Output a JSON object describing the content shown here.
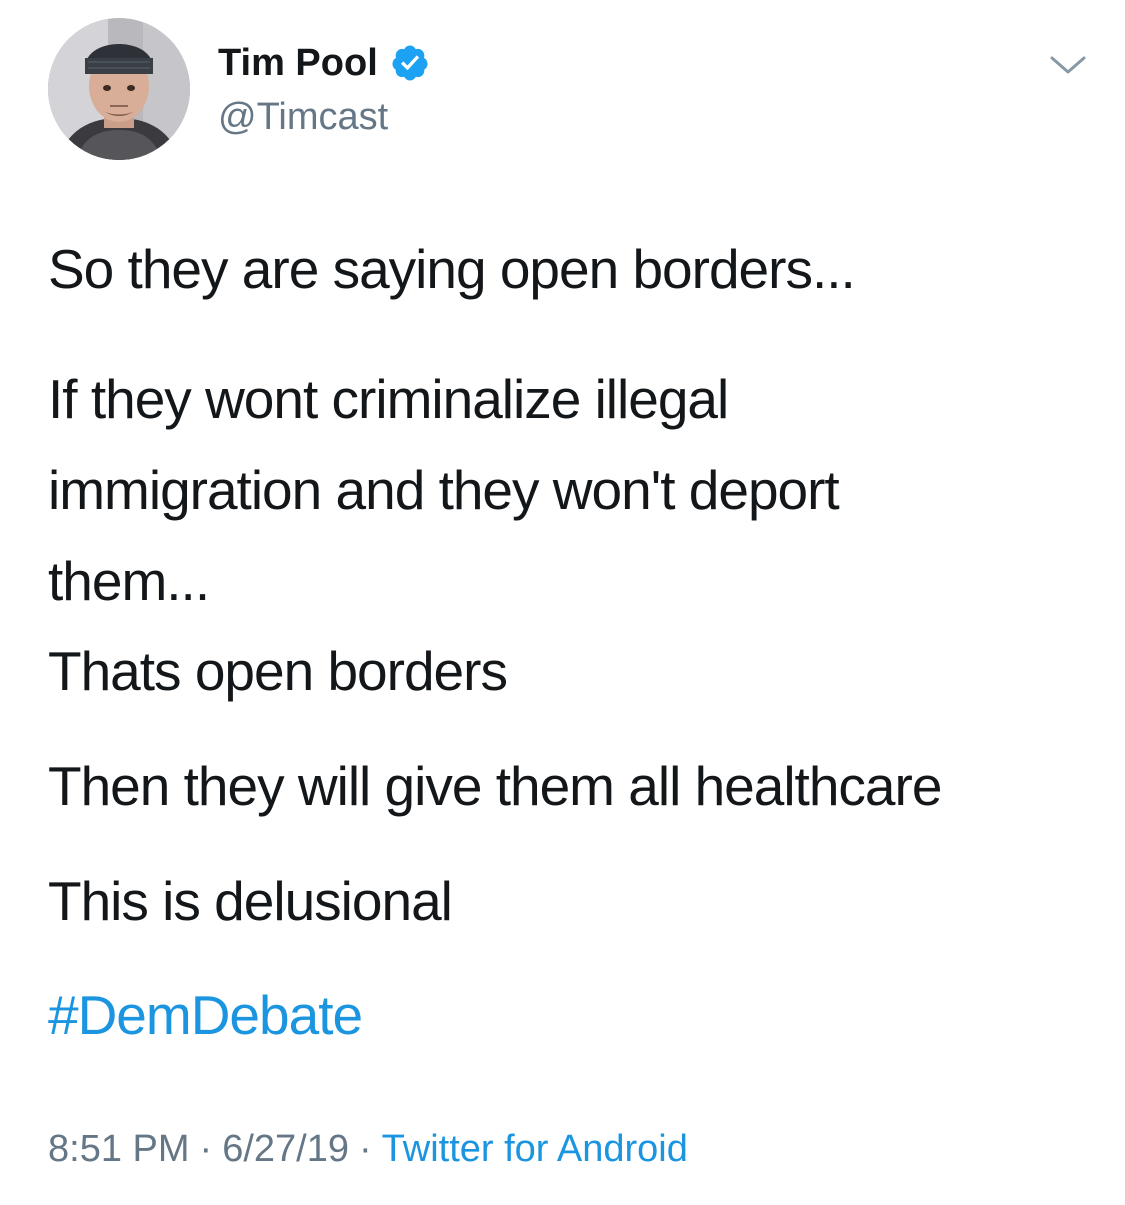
{
  "author": {
    "display_name": "Tim Pool",
    "handle": "@Timcast",
    "verified_icon": "verified-badge-icon",
    "avatar_icon": "profile-photo"
  },
  "menu": {
    "icon": "chevron-down-icon"
  },
  "tweet": {
    "paragraphs": [
      "So they are saying open borders...",
      "If they wont criminalize illegal immigration and they won't deport them...",
      "Thats open borders",
      "Then they will give them all healthcare",
      "This is delusional"
    ],
    "hashtag": "#DemDebate"
  },
  "meta": {
    "time": "8:51 PM",
    "separator": "·",
    "date": "6/27/19",
    "source": "Twitter for Android"
  },
  "colors": {
    "text": "#14171a",
    "secondary": "#657786",
    "link": "#1b95e0",
    "verified": "#1da1f2",
    "background": "#ffffff"
  }
}
